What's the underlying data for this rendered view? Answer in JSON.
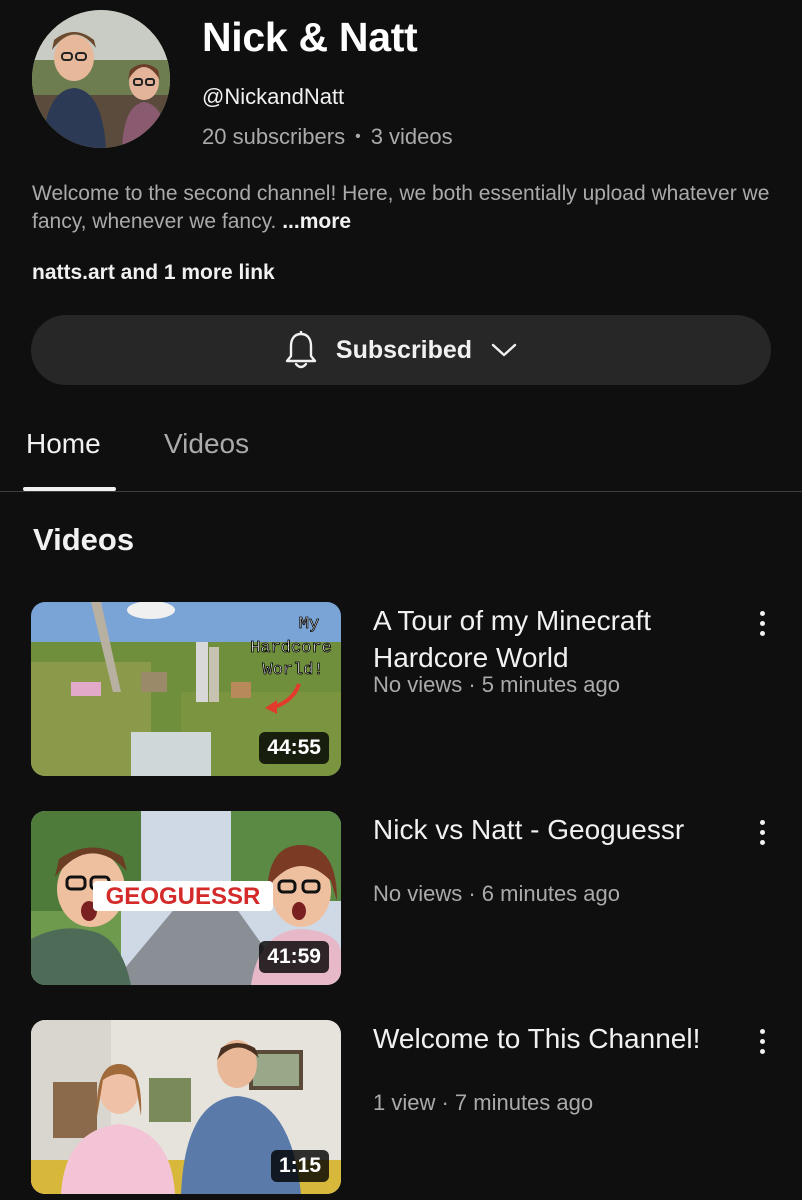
{
  "channel": {
    "name": "Nick & Natt",
    "handle": "@NickandNatt",
    "subscribers": "20 subscribers",
    "separator": "•",
    "video_count": "3 videos",
    "description": "Welcome to the second channel! Here, we both essentially upload whatever we fancy, whenever we fancy.",
    "more_label": "...more",
    "links": "natts.art and 1 more link"
  },
  "subscribe": {
    "label": "Subscribed",
    "bell_icon": "bell-icon",
    "chevron_icon": "chevron-down-icon"
  },
  "tabs": [
    {
      "label": "Home",
      "active": true
    },
    {
      "label": "Videos",
      "active": false
    }
  ],
  "section": {
    "title": "Videos"
  },
  "videos": [
    {
      "title": "A Tour of my Minecraft Hardcore World",
      "meta": "No views · 5 minutes ago",
      "duration": "44:55",
      "thumb_text": "My Hardcore World!"
    },
    {
      "title": "Nick vs Natt - Geoguessr",
      "meta": "No views · 6 minutes ago",
      "duration": "41:59",
      "thumb_text": "GEOGUESSR"
    },
    {
      "title": "Welcome to This Channel!",
      "meta": "1 view · 7 minutes ago",
      "duration": "1:15"
    }
  ],
  "colors": {
    "background": "#0f0f0f",
    "button_bg": "#272727",
    "secondary_text": "#aaaaaa",
    "primary_text": "#f1f1f1"
  }
}
